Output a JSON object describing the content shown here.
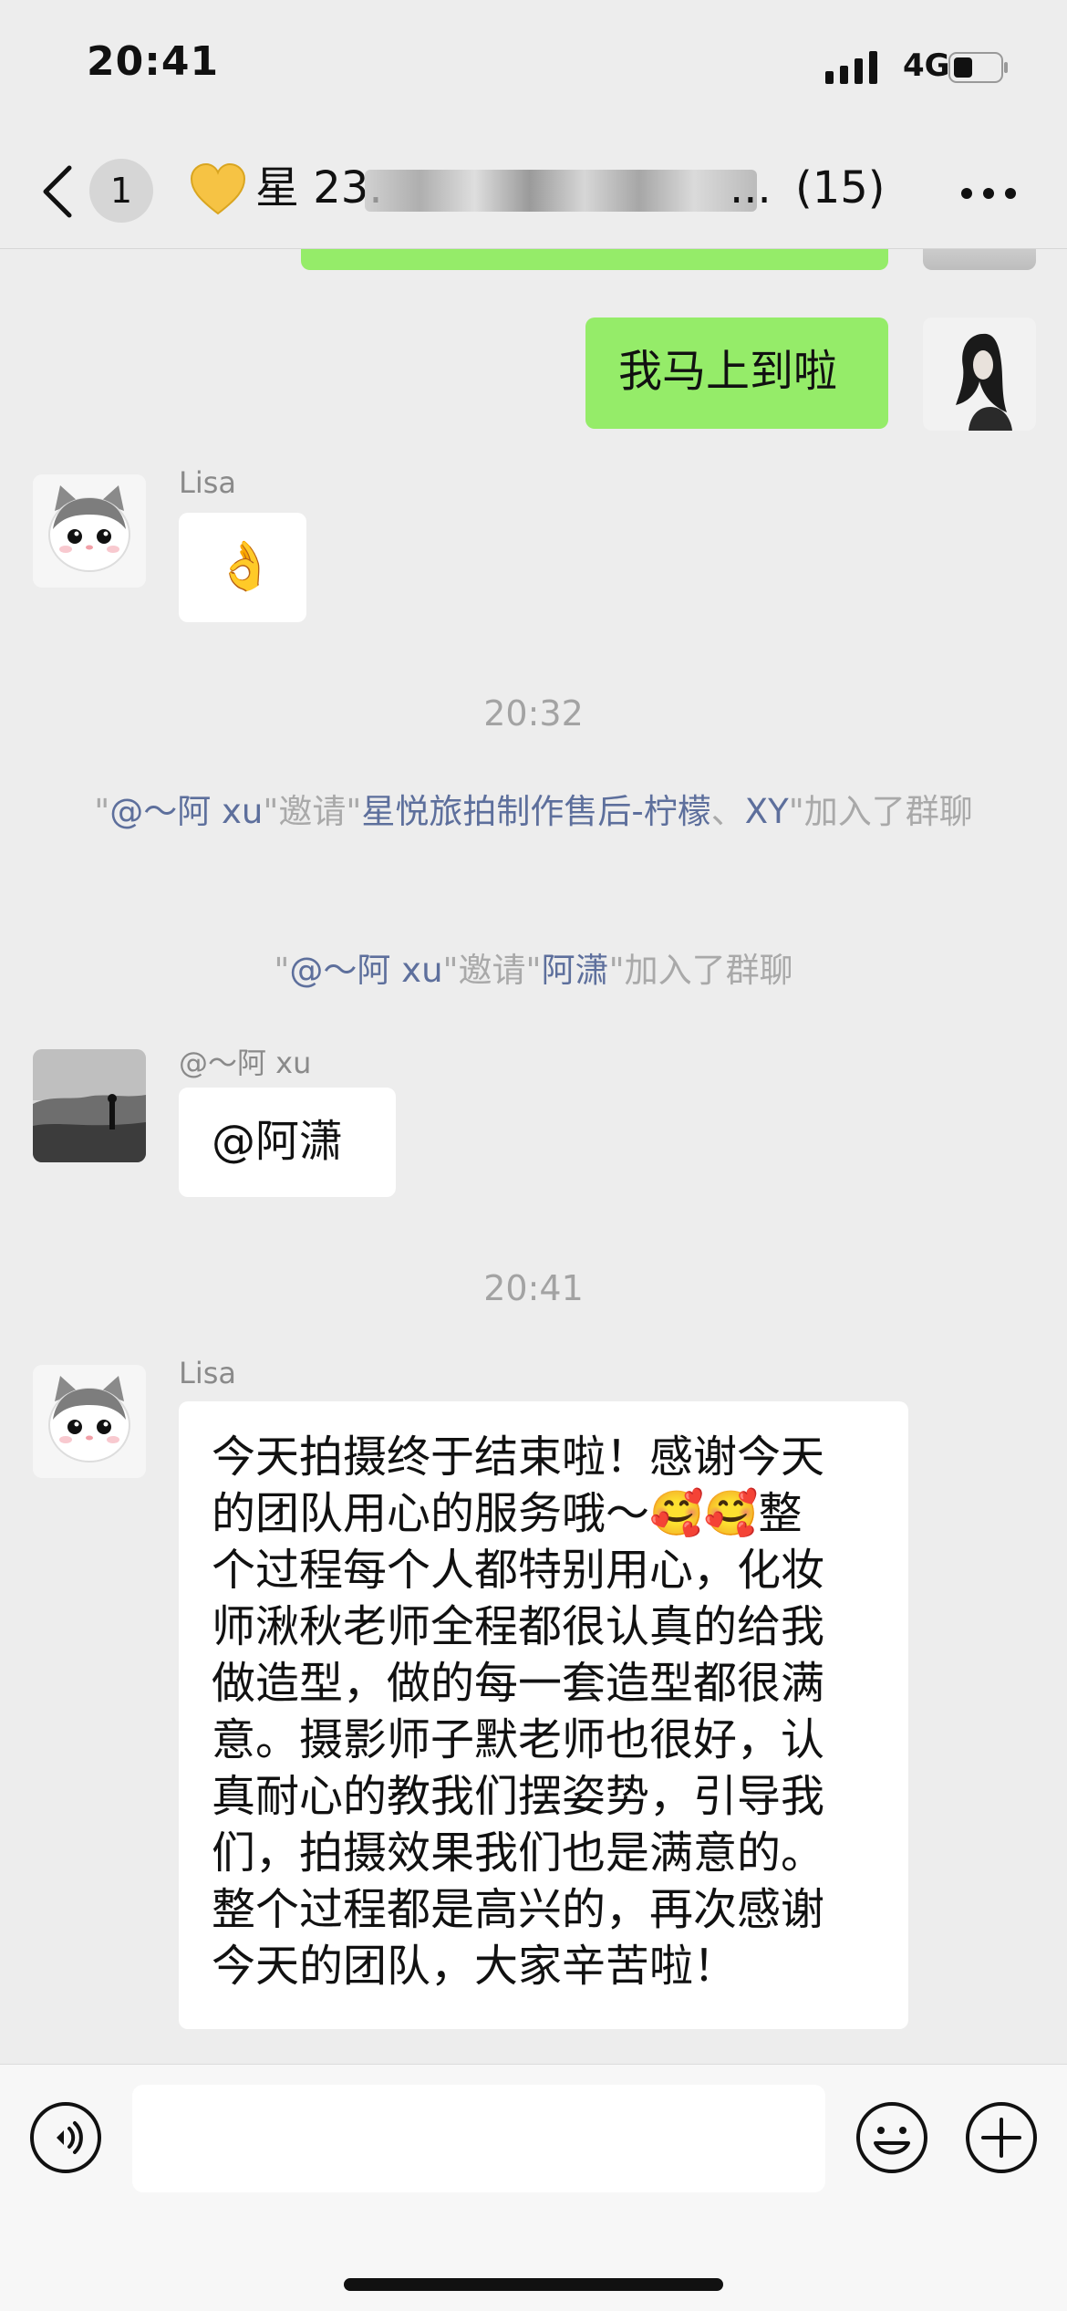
{
  "status_bar": {
    "time": "20:41",
    "network": "4G"
  },
  "nav": {
    "unread_badge": "1",
    "title_prefix": "星 23.",
    "title_ellipsis": "...",
    "member_count": "(15)"
  },
  "messages": {
    "outgoing_1": "我马上到啦",
    "lisa_name": "Lisa",
    "lisa_emoji": "👌",
    "time_1": "20:32",
    "system_1": {
      "q1": "\"",
      "inviter": "@～阿 xu",
      "mid": "\"邀请\"",
      "invitees": "星悦旅拍制作售后-柠檬",
      "sep": "、",
      "invitee2": "XY",
      "end": "\"加入了群聊"
    },
    "system_2": {
      "q1": "\"",
      "inviter": "@～阿 xu",
      "mid": "\"邀请\"",
      "invitee": "阿潇",
      "end": "\"加入了群聊"
    },
    "axu_name": "@～阿 xu",
    "axu_text": "@阿潇",
    "time_2": "20:41",
    "lisa_name_2": "Lisa",
    "long_lines": [
      "今天拍摄终于结束啦！感谢今天",
      "的团队用心的服务哦～🥰🥰整",
      "个过程每个人都特别用心，化妆",
      "师湫秋老师全程都很认真的给我",
      "做造型，做的每一套造型都很满",
      "意。摄影师子默老师也很好，认",
      "真耐心的教我们摆姿势，引导我",
      "们，拍摄效果我们也是满意的。",
      "整个过程都是高兴的，再次感谢",
      "今天的团队，大家辛苦啦！"
    ]
  },
  "icons": [
    "signal-icon",
    "battery-icon",
    "back-icon",
    "heart-icon",
    "more-icon",
    "voice-icon",
    "emoji-icon",
    "plus-icon"
  ],
  "colors": {
    "background": "#ededed",
    "outgoing_bubble": "#95ec69",
    "incoming_bubble": "#ffffff",
    "system_link": "#5d6f9c"
  }
}
